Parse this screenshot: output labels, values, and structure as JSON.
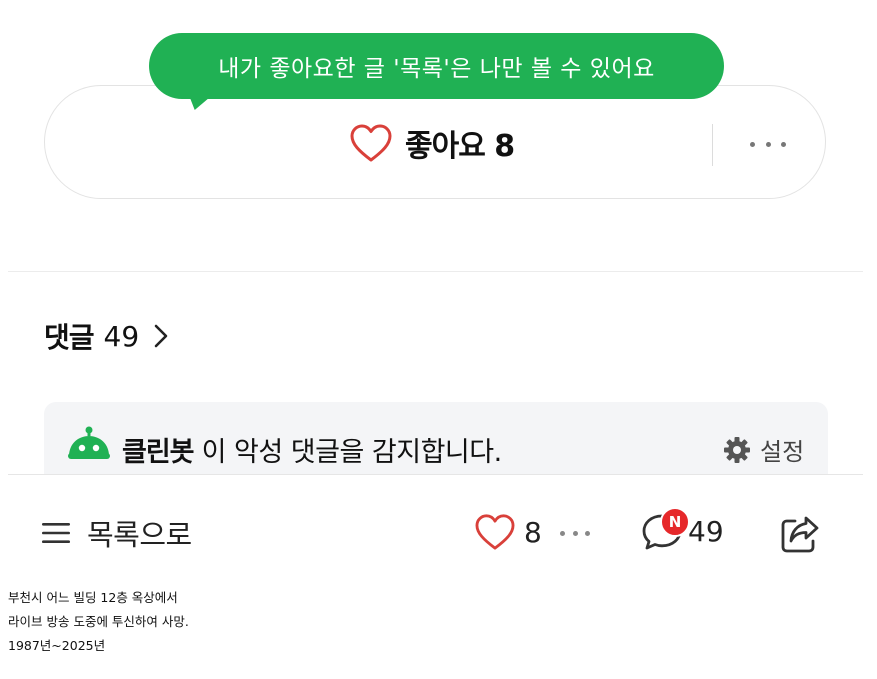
{
  "like_box": {
    "heart_icon": "heart-outline-icon",
    "label": "좋아요",
    "count": "8",
    "more_icon": "more-dots-icon"
  },
  "tooltip": {
    "text": "내가 좋아요한 글 '목록'은 나만 볼 수 있어요"
  },
  "comments": {
    "title": "댓글",
    "count": "49"
  },
  "cleanbot": {
    "name": "클린봇",
    "message": " 이 악성 댓글을 감지합니다.",
    "settings_label": "설정"
  },
  "bottom_bar": {
    "list_label": "목록으로",
    "like_count": "8",
    "comment_count": "49",
    "new_badge": "N"
  },
  "caption": {
    "line1": "부천시 어느 빌딩 12층 옥상에서",
    "line2": "라이브 방송 도중에 투신하여 사망.",
    "line3": "1987년~2025년"
  },
  "colors": {
    "brand_green": "#20b154",
    "heart_red": "#d9403a",
    "badge_red": "#e6282a"
  }
}
